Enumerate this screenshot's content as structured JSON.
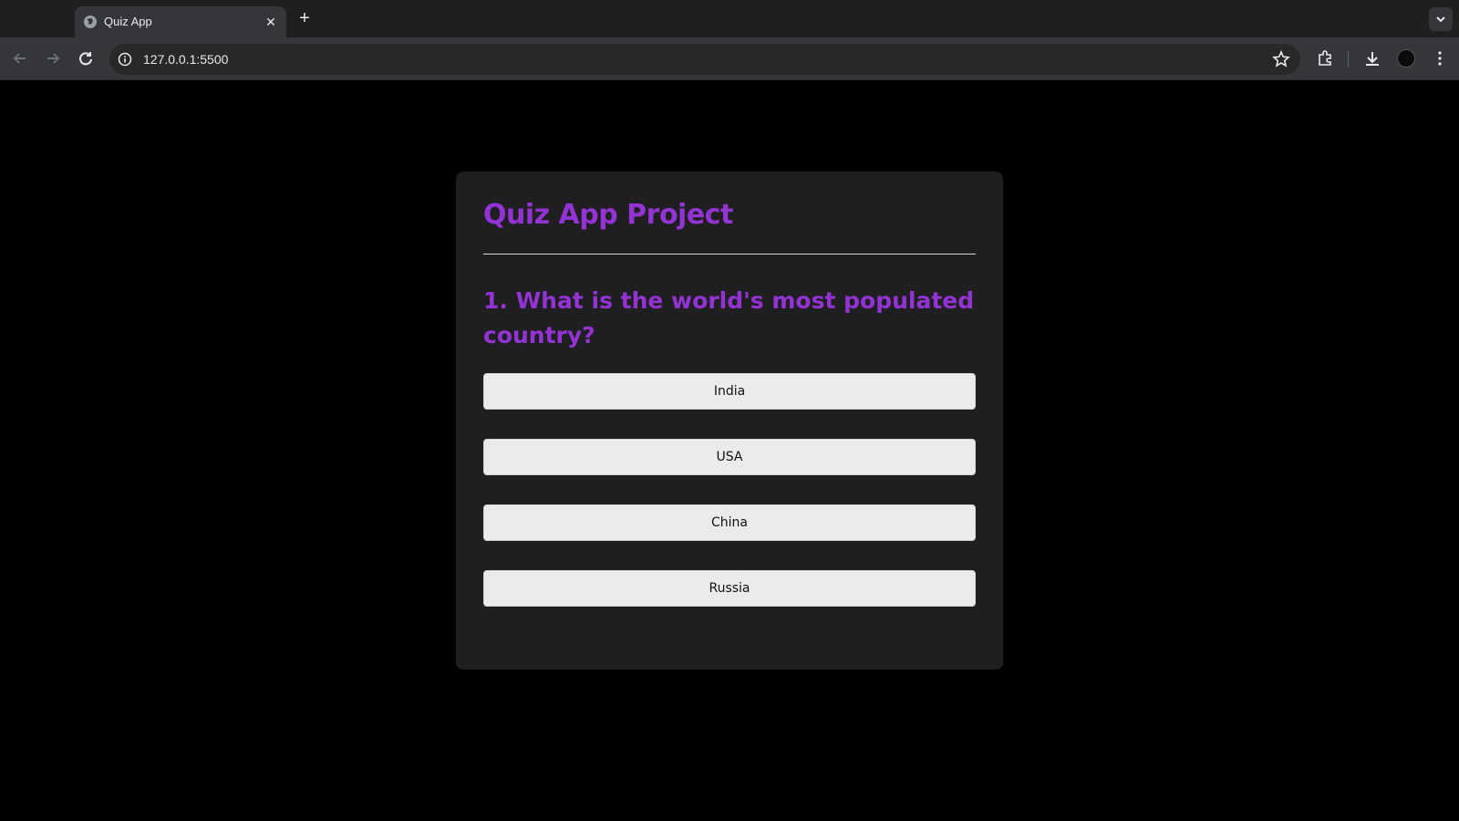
{
  "browser": {
    "tab_title": "Quiz App",
    "url": "127.0.0.1:5500",
    "icons": {
      "favicon": "globe-icon",
      "close": "close-icon",
      "new_tab": "plus-icon",
      "back": "back-arrow-icon",
      "forward": "forward-arrow-icon",
      "reload": "reload-icon",
      "info": "info-icon",
      "bookmark": "star-icon",
      "extensions": "puzzle-icon",
      "download": "download-icon",
      "menu": "kebab-menu-icon",
      "tab_list": "chevron-down-icon"
    }
  },
  "quiz": {
    "title": "Quiz App Project",
    "question": "1. What is the world's most populated country?",
    "answers": [
      "India",
      "USA",
      "China",
      "Russia"
    ],
    "accent_color": "#9433d4"
  }
}
